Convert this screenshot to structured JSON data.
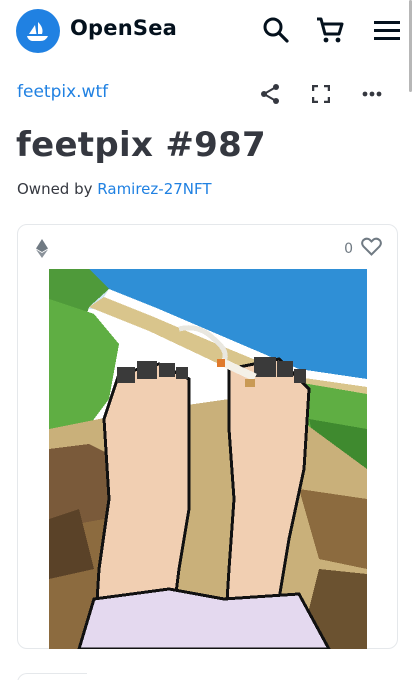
{
  "header": {
    "brand": "OpenSea",
    "icons": [
      "opensea-logo-icon",
      "search-icon",
      "cart-icon",
      "menu-icon"
    ]
  },
  "collection": {
    "name": "feetpix.wtf"
  },
  "actions": [
    "share-icon",
    "fullscreen-icon",
    "more-icon"
  ],
  "item": {
    "title": "feetpix #987",
    "owned_by_label": "Owned by",
    "owner": "Ramirez-27NFT"
  },
  "card": {
    "chain_icon": "ethereum-icon",
    "like_count": "0",
    "like_icon": "heart-icon"
  },
  "colors": {
    "accent": "#2081e2",
    "text": "#353840",
    "border": "#e5e8eb"
  }
}
